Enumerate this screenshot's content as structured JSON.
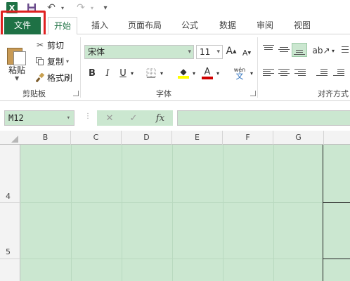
{
  "quick_access": {
    "app_icon_letter": "X",
    "save_glyph": "💾",
    "undo_glyph": "↶",
    "redo_glyph": "↷",
    "customize_glyph": "▾"
  },
  "tabs": [
    {
      "label": "文件",
      "id": "file"
    },
    {
      "label": "开始",
      "id": "home"
    },
    {
      "label": "插入",
      "id": "insert"
    },
    {
      "label": "页面布局",
      "id": "page-layout"
    },
    {
      "label": "公式",
      "id": "formulas"
    },
    {
      "label": "数据",
      "id": "data"
    },
    {
      "label": "审阅",
      "id": "review"
    },
    {
      "label": "视图",
      "id": "view"
    }
  ],
  "clipboard": {
    "paste_label": "粘贴",
    "cut_label": "剪切",
    "copy_label": "复制",
    "format_painter_label": "格式刷",
    "group_label": "剪贴板"
  },
  "font": {
    "font_name": "宋体",
    "font_size": "11",
    "grow_label": "A",
    "shrink_label": "A",
    "bold": "B",
    "italic": "I",
    "underline": "U",
    "fill_color_label": "A",
    "font_color_label": "A",
    "phonetic_label": "wén",
    "group_label": "字体",
    "fill_color": "#ffff00",
    "font_color": "#d00000"
  },
  "alignment": {
    "group_label": "对齐方式"
  },
  "formula_bar": {
    "name_box": "M12",
    "cancel_glyph": "✕",
    "enter_glyph": "✓",
    "fx_label": "fx",
    "formula_value": ""
  },
  "grid": {
    "columns": [
      "B",
      "C",
      "D",
      "E",
      "F",
      "G"
    ],
    "rows": [
      "4",
      "5"
    ],
    "selection_color": "#cbe7d0"
  },
  "accent_color": "#217346"
}
